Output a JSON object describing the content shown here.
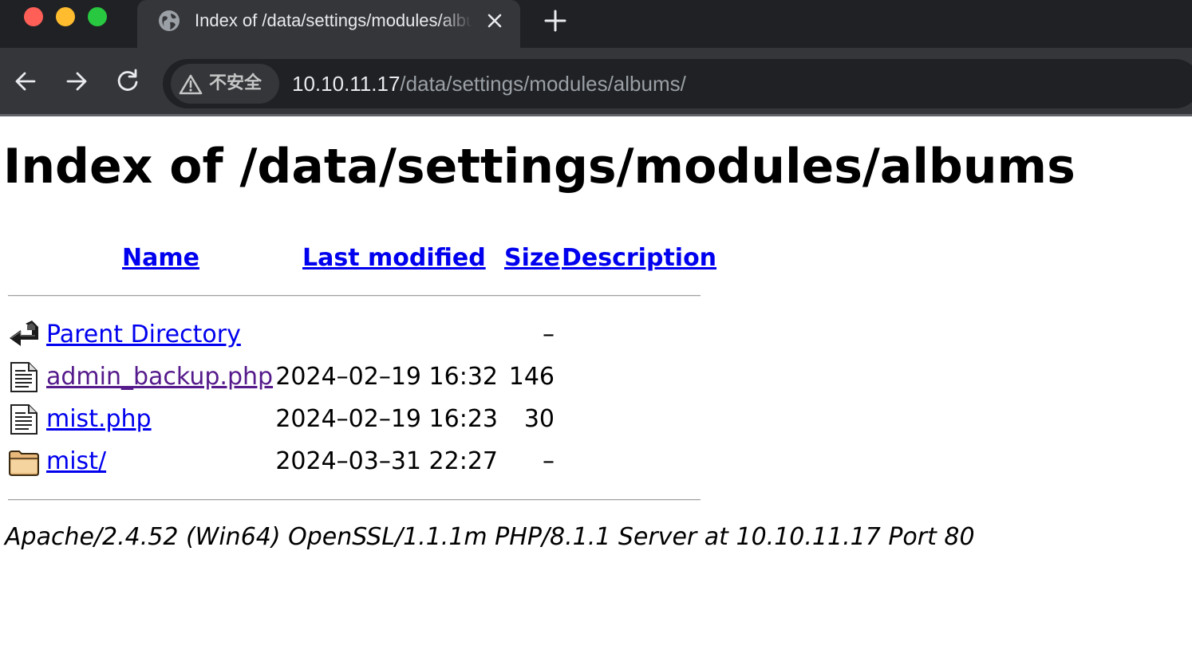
{
  "browser": {
    "tab": {
      "title": "Index of /data/settings/modules/albums",
      "favicon": "globe-icon",
      "close_icon": "close-icon"
    },
    "new_tab_icon": "plus-icon",
    "toolbar": {
      "back_icon": "arrow-left-icon",
      "forward_icon": "arrow-right-icon",
      "reload_icon": "reload-icon"
    },
    "address_bar": {
      "security_icon": "warning-triangle-icon",
      "security_label": "不安全",
      "url_host": "10.10.11.17",
      "url_path": "/data/settings/modules/albums/"
    },
    "colors": {
      "tabstrip": "#202124",
      "toolbar": "#35363a",
      "text": "#e8eaed",
      "muted": "#9aa0a6"
    }
  },
  "page": {
    "heading": "Index of /data/settings/modules/albums",
    "columns": {
      "name": "Name",
      "last_modified": "Last modified",
      "size": "Size",
      "description": "Description"
    },
    "entries": [
      {
        "icon": "parent-directory-icon",
        "name": "Parent Directory",
        "modified": "",
        "size": "–",
        "description": "",
        "visited": false
      },
      {
        "icon": "text-file-icon",
        "name": "admin_backup.php",
        "modified": "2024–02–19 16:32",
        "size": "146",
        "description": "",
        "visited": true
      },
      {
        "icon": "text-file-icon",
        "name": "mist.php",
        "modified": "2024–02–19 16:23",
        "size": "30",
        "description": "",
        "visited": false
      },
      {
        "icon": "folder-icon",
        "name": "mist/",
        "modified": "2024–03–31 22:27",
        "size": "–",
        "description": "",
        "visited": false
      }
    ],
    "footer": "Apache/2.4.52 (Win64) OpenSSL/1.1.1m PHP/8.1.1 Server at 10.10.11.17 Port 80",
    "colors": {
      "link": "#0000ee",
      "visited_link": "#551a8b"
    }
  }
}
